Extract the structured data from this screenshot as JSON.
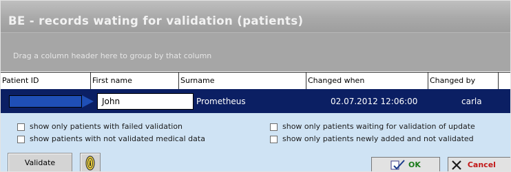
{
  "window": {
    "title": "BE - records wating for validation (patients)"
  },
  "grid": {
    "group_hint": "Drag a column header here to group by that column",
    "columns": [
      {
        "label": "Patient ID"
      },
      {
        "label": "First name"
      },
      {
        "label": "Surname"
      },
      {
        "label": "Changed when"
      },
      {
        "label": "Changed by"
      }
    ],
    "rows": [
      {
        "patient_id": "",
        "first_name": "John",
        "surname": "Prometheus",
        "changed_when": "02.07.2012 12:06:00",
        "changed_by": "carla"
      }
    ]
  },
  "filters": {
    "failed_validation": {
      "label": "show only patients with failed validation",
      "checked": false
    },
    "not_validated_medical": {
      "label": "show patients with not validated  medical data",
      "checked": false
    },
    "waiting_update": {
      "label": "show only patients waiting for validation of update",
      "checked": false
    },
    "newly_added": {
      "label": "show only patients newly added and not validated",
      "checked": false
    }
  },
  "buttons": {
    "validate": "Validate",
    "ok": "OK",
    "cancel": "Cancel"
  },
  "icons": {
    "info": "info-icon",
    "ok": "checkmark-icon",
    "cancel": "x-icon"
  },
  "colors": {
    "selected_row": "#0b1f63",
    "options_panel": "#cfe3f4",
    "ok_text": "#1a7a1a",
    "cancel_text": "#c21717"
  }
}
